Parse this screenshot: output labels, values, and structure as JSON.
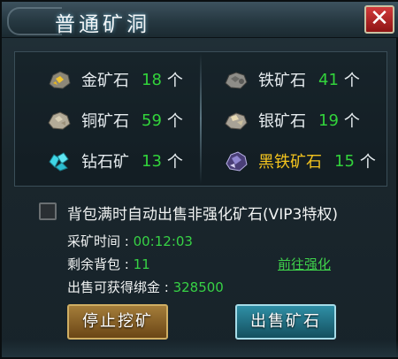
{
  "window": {
    "title": "普通矿洞",
    "close_label": "✕"
  },
  "ores": [
    {
      "name": "金矿石",
      "count": "18",
      "unit": "个",
      "icon": "gold-ore-icon"
    },
    {
      "name": "铁矿石",
      "count": "41",
      "unit": "个",
      "icon": "iron-ore-icon"
    },
    {
      "name": "铜矿石",
      "count": "59",
      "unit": "个",
      "icon": "copper-ore-icon"
    },
    {
      "name": "银矿石",
      "count": "19",
      "unit": "个",
      "icon": "silver-ore-icon"
    },
    {
      "name": "钻石矿",
      "count": "13",
      "unit": "个",
      "icon": "diamond-ore-icon"
    },
    {
      "name": "黑铁矿石",
      "count": "15",
      "unit": "个",
      "icon": "black-iron-ore-icon"
    }
  ],
  "auto_sell": {
    "checked": false,
    "label": "背包满时自动出售非强化矿石(VIP3特权)"
  },
  "stats": {
    "mining_time_label": "采矿时间 : ",
    "mining_time_value": "00:12:03",
    "bag_label": "剩余背包 : ",
    "bag_value": "11",
    "gold_label": "出售可获得绑金 : ",
    "gold_value": "328500"
  },
  "goto_enhance_link": "前往强化",
  "buttons": {
    "stop_label": "停止挖矿",
    "sell_label": "出售矿石"
  },
  "colors": {
    "count_green": "#32d33b",
    "black_iron_gold": "#f2c31e",
    "close_red": "#c02626"
  }
}
